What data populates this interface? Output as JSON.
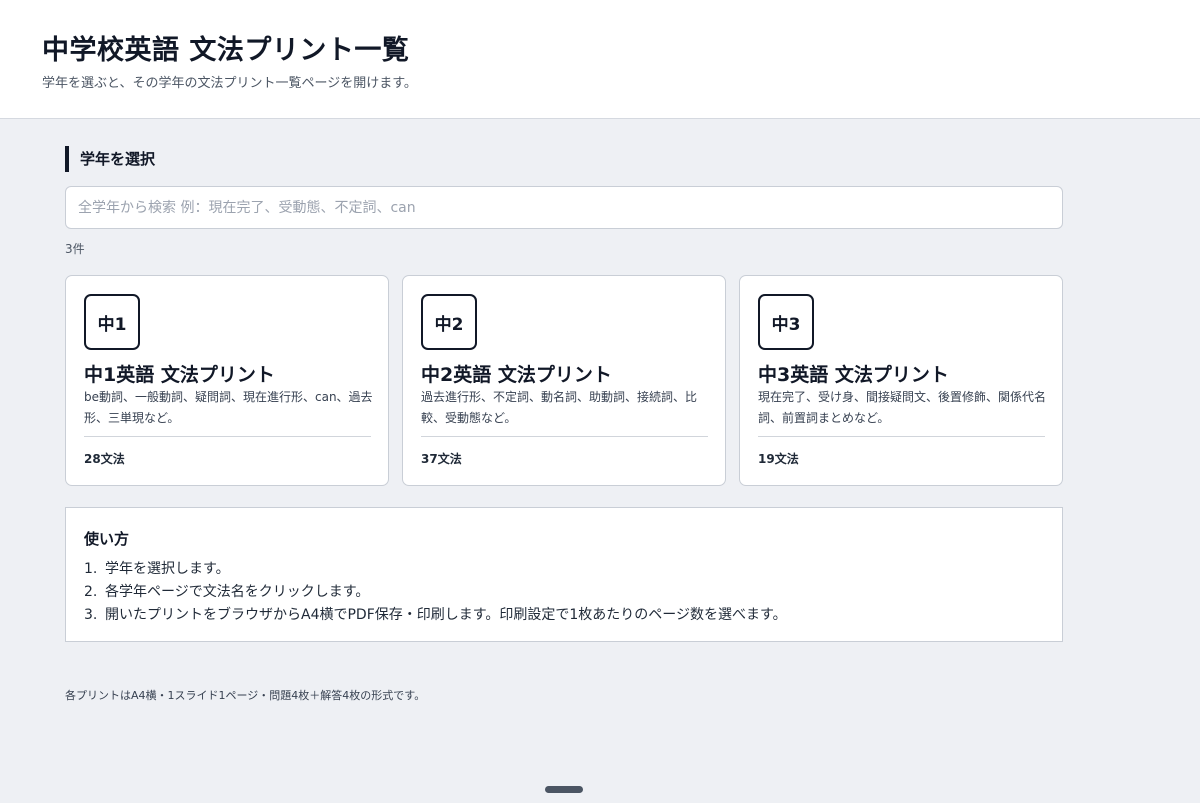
{
  "header": {
    "title": "中学校英語 文法プリント一覧",
    "subtitle": "学年を選ぶと、その学年の文法プリント一覧ページを開けます。"
  },
  "grade_select": {
    "heading": "学年を選択",
    "search_placeholder": "全学年から検索 例：現在完了、受動態、不定詞、can",
    "search_value": "",
    "result_count": "3件"
  },
  "cards": [
    {
      "badge": "中1",
      "title": "中1英語 文法プリント",
      "description": "be動詞、一般動詞、疑問詞、現在進行形、can、過去形、三単現など。",
      "grammar_count": "28文法"
    },
    {
      "badge": "中2",
      "title": "中2英語 文法プリント",
      "description": "過去進行形、不定詞、動名詞、助動詞、接続詞、比較、受動態など。",
      "grammar_count": "37文法"
    },
    {
      "badge": "中3",
      "title": "中3英語 文法プリント",
      "description": "現在完了、受け身、間接疑問文、後置修飾、関係代名詞、前置詞まとめなど。",
      "grammar_count": "19文法"
    }
  ],
  "howto": {
    "heading": "使い方",
    "steps": [
      {
        "num": "1.",
        "text": "学年を選択します。"
      },
      {
        "num": "2.",
        "text": "各学年ページで文法名をクリックします。"
      },
      {
        "num": "3.",
        "text": "開いたプリントをブラウザからA4横でPDF保存・印刷します。印刷設定で1枚あたりのページ数を選べます。"
      }
    ]
  },
  "footer_note": "各プリントはA4横・1スライド1ページ・問題4枚＋解答4枚の形式です。"
}
